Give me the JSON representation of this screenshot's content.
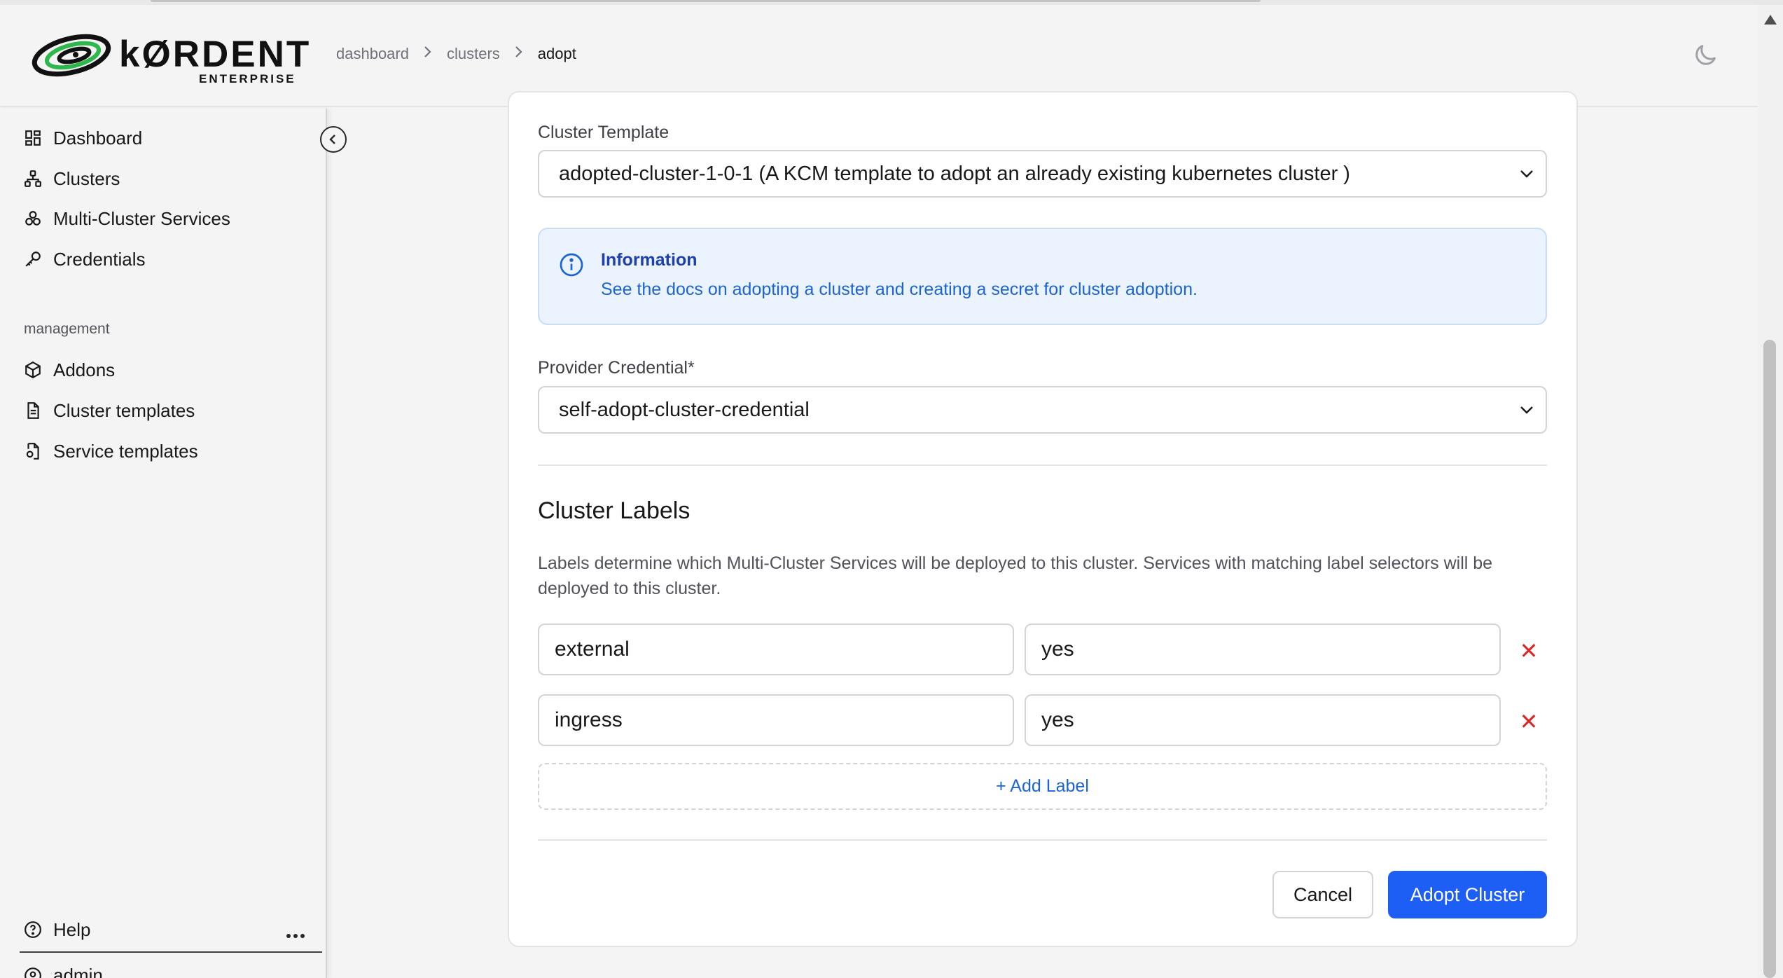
{
  "app": {
    "logo_word": "kØRDENT",
    "logo_sub": "ENTERPRISE"
  },
  "breadcrumb": [
    "dashboard",
    "clusters",
    "adopt"
  ],
  "sidebar": {
    "items": [
      {
        "label": "Dashboard",
        "icon": "dashboard-grid-icon"
      },
      {
        "label": "Clusters",
        "icon": "network-icon"
      },
      {
        "label": "Multi-Cluster Services",
        "icon": "boxes-icon"
      },
      {
        "label": "Credentials",
        "icon": "key-icon"
      }
    ],
    "management_label": "management",
    "management_items": [
      {
        "label": "Addons",
        "icon": "package-icon"
      },
      {
        "label": "Cluster templates",
        "icon": "file-text-icon"
      },
      {
        "label": "Service templates",
        "icon": "file-cog-icon"
      }
    ],
    "help_label": "Help",
    "user_label": "admin"
  },
  "form": {
    "template_label": "Cluster Template",
    "template_value": "adopted-cluster-1-0-1 (A KCM template to adopt an already existing kubernetes cluster )",
    "info_title": "Information",
    "info_text": "See the docs on adopting a cluster and creating a secret for cluster adoption.",
    "credential_label": "Provider Credential*",
    "credential_value": "self-adopt-cluster-credential",
    "labels_title": "Cluster Labels",
    "labels_desc": "Labels determine which Multi-Cluster Services will be deployed to this cluster. Services with matching label selectors will be deployed to this cluster.",
    "labels": [
      {
        "key": "external",
        "value": "yes"
      },
      {
        "key": "ingress",
        "value": "yes"
      }
    ],
    "remove_symbol": "✕",
    "add_label": "+ Add Label",
    "cancel": "Cancel",
    "submit": "Adopt Cluster"
  },
  "colors": {
    "primary": "#1d5ef5",
    "info_bg": "#eaf3fe",
    "danger": "#dc2626"
  }
}
